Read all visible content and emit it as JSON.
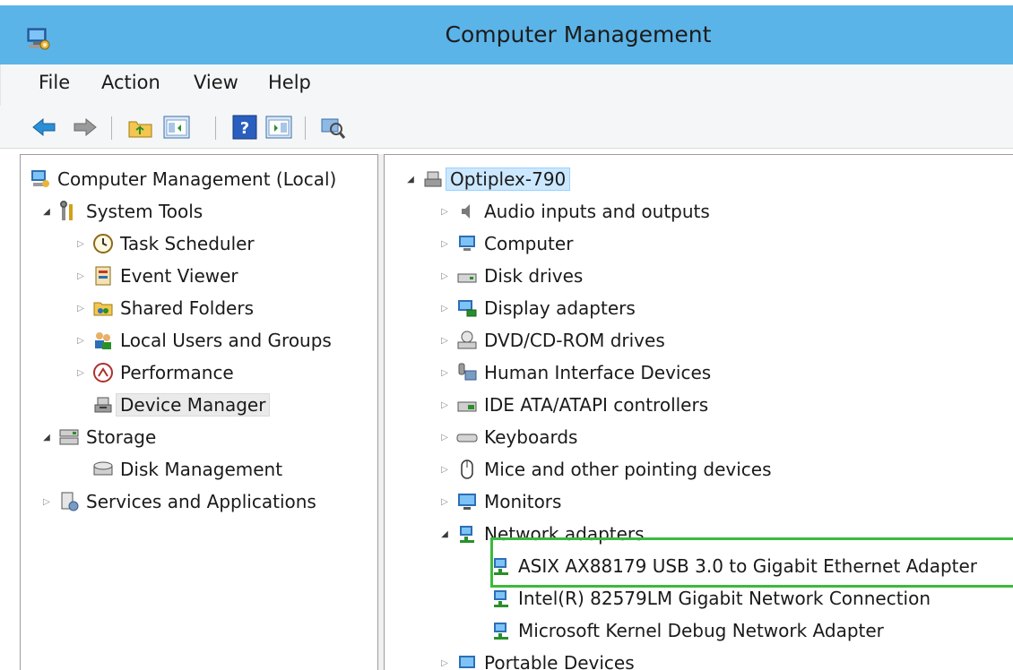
{
  "window": {
    "title": "Computer Management",
    "icon": "computer-management-icon"
  },
  "menu": [
    "File",
    "Action",
    "View",
    "Help"
  ],
  "toolbar": {
    "buttons": [
      {
        "name": "back-button",
        "icon": "back-arrow-icon"
      },
      {
        "name": "forward-button",
        "icon": "forward-arrow-icon"
      },
      {
        "name": "up-folder-button",
        "icon": "folder-up-icon"
      },
      {
        "name": "show-hide-console-tree-button",
        "icon": "console-tree-icon"
      },
      {
        "name": "help-button",
        "icon": "help-icon"
      },
      {
        "name": "show-hide-action-pane-button",
        "icon": "action-pane-icon"
      },
      {
        "name": "scan-hardware-button",
        "icon": "scan-hardware-icon"
      }
    ]
  },
  "tree": {
    "root": "Computer Management (Local)",
    "system_tools": "System Tools",
    "task_scheduler": "Task Scheduler",
    "event_viewer": "Event Viewer",
    "shared_folders": "Shared Folders",
    "local_users": "Local Users and Groups",
    "performance": "Performance",
    "device_manager": "Device Manager",
    "storage": "Storage",
    "disk_management": "Disk Management",
    "services": "Services and Applications"
  },
  "devices": {
    "root": "Optiplex-790",
    "categories": [
      "Audio inputs and outputs",
      "Computer",
      "Disk drives",
      "Display adapters",
      "DVD/CD-ROM drives",
      "Human Interface Devices",
      "IDE ATA/ATAPI controllers",
      "Keyboards",
      "Mice and other pointing devices",
      "Monitors"
    ],
    "network_adapters": "Network adapters",
    "adapters": [
      "ASIX AX88179 USB 3.0 to Gigabit Ethernet Adapter",
      "Intel(R) 82579LM Gigabit Network Connection",
      "Microsoft Kernel Debug Network Adapter"
    ],
    "portable": "Portable Devices"
  },
  "colors": {
    "titlebar": "#5bb4e8",
    "highlight_box": "#3cba3c",
    "selection": "#cce8ff"
  }
}
